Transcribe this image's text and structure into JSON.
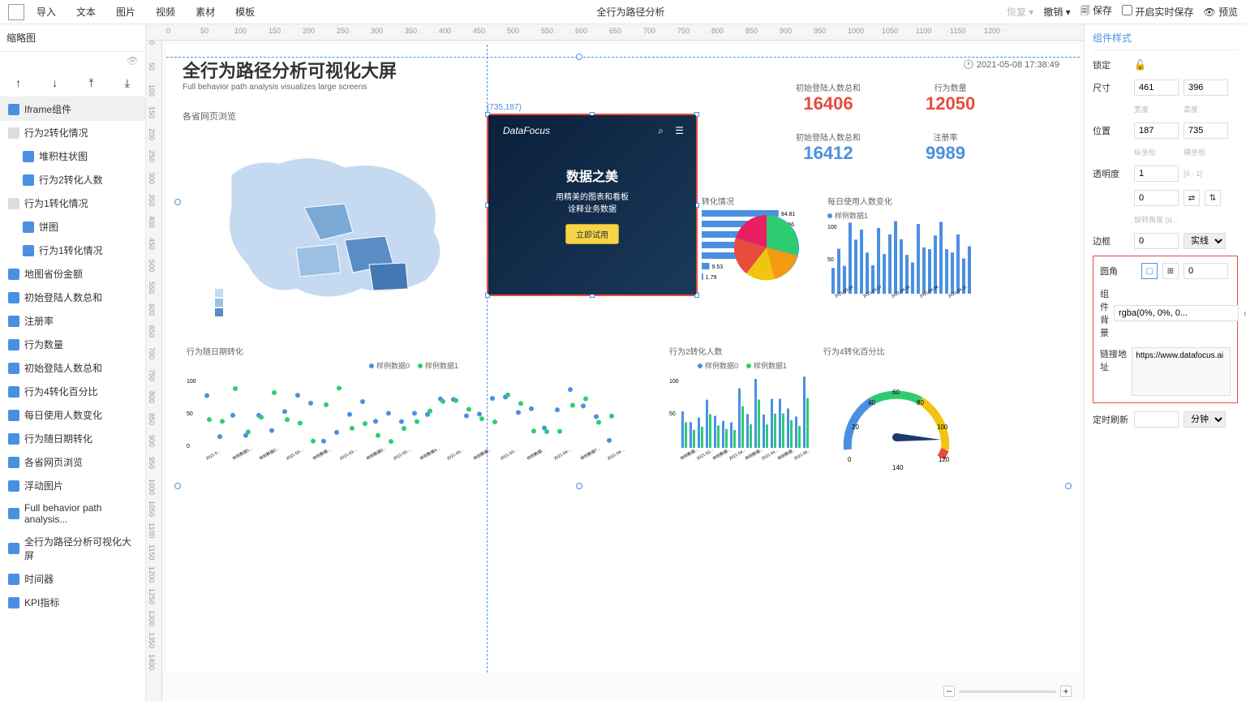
{
  "topbar": {
    "menu": [
      "导入",
      "文本",
      "图片",
      "视频",
      "素材",
      "模板"
    ],
    "title": "全行为路径分析",
    "restore": "恢复",
    "undo": "撤销",
    "save": "保存",
    "realtime_save": "开启实时保存",
    "preview": "预览"
  },
  "left": {
    "thumb": "缩略图",
    "items": [
      {
        "label": "Iframe组件",
        "type": "item",
        "selected": true
      },
      {
        "label": "行为2转化情况",
        "type": "group"
      },
      {
        "label": "堆积柱状图",
        "type": "child"
      },
      {
        "label": "行为2转化人数",
        "type": "child"
      },
      {
        "label": "行为1转化情况",
        "type": "group"
      },
      {
        "label": "饼图",
        "type": "child"
      },
      {
        "label": "行为1转化情况",
        "type": "child"
      },
      {
        "label": "地图省份金额",
        "type": "item"
      },
      {
        "label": "初始登陆人数总和",
        "type": "item"
      },
      {
        "label": "注册率",
        "type": "item"
      },
      {
        "label": "行为数量",
        "type": "item"
      },
      {
        "label": "初始登陆人数总和",
        "type": "item"
      },
      {
        "label": "行为4转化百分比",
        "type": "item"
      },
      {
        "label": "每日使用人数变化",
        "type": "item"
      },
      {
        "label": "行为随日期转化",
        "type": "item"
      },
      {
        "label": "各省网页浏览",
        "type": "item"
      },
      {
        "label": "浮动图片",
        "type": "item"
      },
      {
        "label": "Full behavior path analysis...",
        "type": "item"
      },
      {
        "label": "全行为路径分析可视化大屏",
        "type": "item"
      },
      {
        "label": "时间器",
        "type": "item"
      },
      {
        "label": "KPI指标",
        "type": "item"
      }
    ]
  },
  "rulers": {
    "h": [
      "0",
      "50",
      "100",
      "150",
      "200",
      "250",
      "300",
      "350",
      "400",
      "450",
      "500",
      "550",
      "600",
      "650",
      "700",
      "750",
      "800",
      "850",
      "900",
      "950",
      "1000",
      "1050",
      "1100",
      "1150",
      "1200"
    ],
    "v": [
      "0",
      "50",
      "100",
      "150",
      "200",
      "250",
      "300",
      "350",
      "400",
      "450",
      "500",
      "550",
      "600",
      "650",
      "700",
      "750",
      "800",
      "850",
      "900",
      "950",
      "1000",
      "1050",
      "1100",
      "1150",
      "1200",
      "1250",
      "1300",
      "1350",
      "1400"
    ]
  },
  "dashboard": {
    "title": "全行为路径分析可视化大屏",
    "subtitle": "Full behavior path analysis visualizes large screens",
    "time": "2021-05-08 17:38:49",
    "map_title": "各省网页浏览",
    "kpi": [
      {
        "label": "初始登陆人数总和",
        "val": "16406",
        "cls": "red"
      },
      {
        "label": "行为数量",
        "val": "12050",
        "cls": "red"
      },
      {
        "label": "初始登陆人数总和",
        "val": "16412",
        "cls": "blue"
      },
      {
        "label": "注册率",
        "val": "9989",
        "cls": "blue"
      }
    ],
    "sel_coord": "(735,187)",
    "iframe": {
      "brand": "DataFocus",
      "headline": "数据之美",
      "line1": "用精美的图表和看板",
      "line2": "诠释业务数据",
      "cta": "立即试用"
    },
    "bar1": {
      "title": "转化情况",
      "vals": [
        "94.81",
        "93.56",
        "71.13",
        "69.46",
        "60.49",
        "9.53",
        "1.79"
      ]
    },
    "daily": {
      "title": "每日使用人数变化",
      "legend": "样例数据1",
      "x": [
        "2021-03-22",
        "2021-03-27",
        "2021-04-01",
        "2021-04-06",
        "2021-04-11"
      ]
    },
    "scatter": {
      "title": "行为随日期转化",
      "legend": [
        "样例数据0",
        "样例数据1"
      ],
      "x": [
        "2021-0...",
        "样例数据1...",
        "样例数据2...",
        "2021-03-...",
        "样例数据...",
        "2021-03-...",
        "样例数据0...",
        "2021-03-...",
        "样例数据4...",
        "2021-03-...",
        "样例数据...",
        "2021-03-...",
        "样例数据...",
        "2021-04-...",
        "样例数据7...",
        "2021-04-..."
      ]
    },
    "bar2": {
      "title": "行为2转化人数",
      "legend": [
        "样例数据0",
        "样例数据1"
      ],
      "x": [
        "样例数据...",
        "2021-03...",
        "样例数据...",
        "2021-04...",
        "样例数据...",
        "2021-04...",
        "样例数据...",
        "2021-05..."
      ]
    },
    "gauge": {
      "title": "行为4转化百分比",
      "ticks": [
        "0",
        "20",
        "40",
        "60",
        "80",
        "100",
        "120",
        "140"
      ]
    }
  },
  "right": {
    "title": "组件样式",
    "lock": "锁定",
    "size": "尺寸",
    "width": "461",
    "height": "396",
    "w_lbl": "宽度",
    "h_lbl": "高度",
    "pos": "位置",
    "x": "187",
    "y": "735",
    "x_lbl": "纵坐标",
    "y_lbl": "横坐标",
    "opacity": "透明度",
    "opacity_val": "1",
    "opacity_hint": "[0 - 1]",
    "rotate_val": "0",
    "rotate_lbl": "旋转角度 (d...",
    "border": "边框",
    "border_val": "0",
    "border_style": "实线",
    "radius": "圆角",
    "radius_val": "0",
    "bg": "组件背景",
    "bg_val": "rgba(0%, 0%, 0...",
    "link": "链接地址",
    "link_val": "https://www.datafocus.ai",
    "refresh": "定时刷新",
    "refresh_unit": "分钟"
  }
}
